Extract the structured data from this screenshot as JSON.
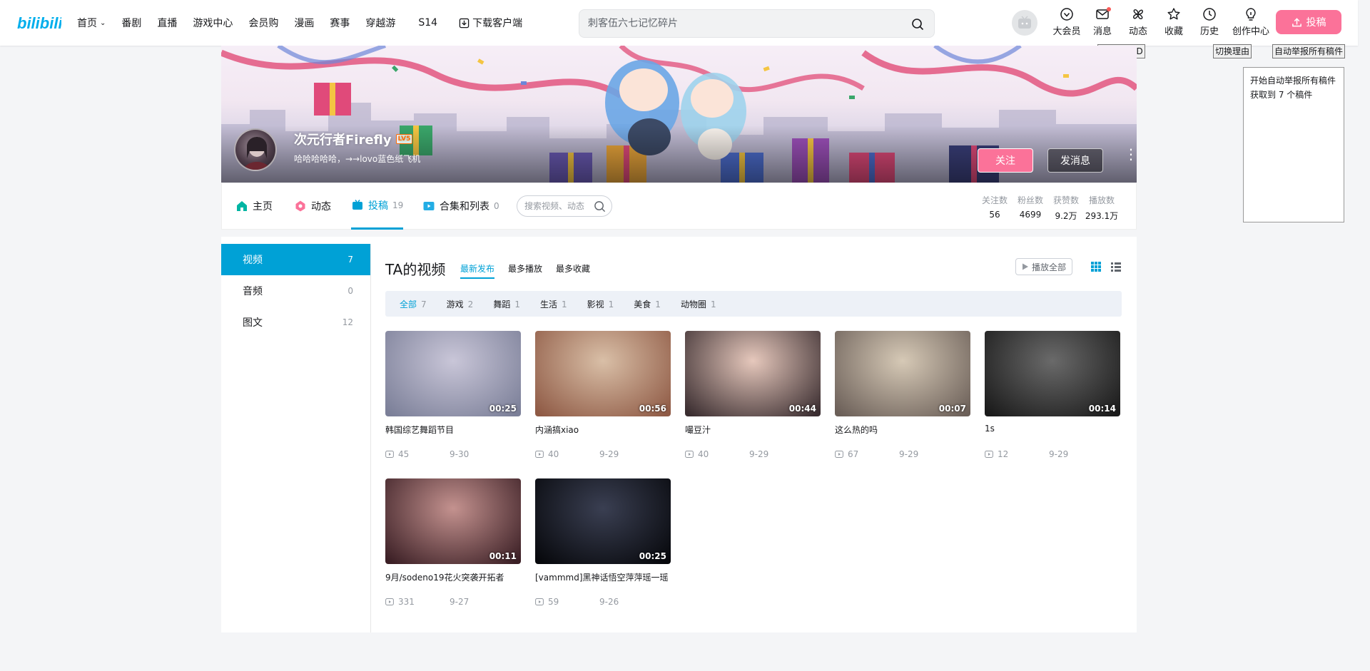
{
  "topnav": {
    "items": [
      "首页",
      "番剧",
      "直播",
      "游戏中心",
      "会员购",
      "漫画",
      "赛事",
      "穿越游",
      "S14",
      "下载客户端"
    ],
    "search_placeholder": "刺客伍六七记忆碎片",
    "icons": [
      {
        "label": "大会员",
        "icon": "vip-icon"
      },
      {
        "label": "消息",
        "icon": "mail-icon"
      },
      {
        "label": "动态",
        "icon": "windmill-icon"
      },
      {
        "label": "收藏",
        "icon": "star-icon"
      },
      {
        "label": "历史",
        "icon": "clock-icon"
      },
      {
        "label": "创作中心",
        "icon": "bulb-icon"
      }
    ],
    "upload_label": "投稿",
    "accent": "#fb7299"
  },
  "extension": {
    "copy_id": "复制用户ID",
    "switch_reason": "切换理由",
    "auto_report": "自动举报所有稿件",
    "log_lines": [
      "开始自动举报所有稿件",
      "获取到 7 个稿件"
    ]
  },
  "profile": {
    "name": "次元行者Firefly",
    "level": "LV5",
    "sign": "哈哈哈哈哈，→→lovo蓝色纸飞机",
    "follow_label": "关注",
    "message_label": "发消息"
  },
  "tabs": [
    {
      "label": "主页",
      "count": ""
    },
    {
      "label": "动态",
      "count": ""
    },
    {
      "label": "投稿",
      "count": "19"
    },
    {
      "label": "合集和列表",
      "count": "0"
    }
  ],
  "tab_search_placeholder": "搜索视频、动态",
  "stats": [
    {
      "label": "关注数",
      "value": "56"
    },
    {
      "label": "粉丝数",
      "value": "4699"
    },
    {
      "label": "获赞数",
      "value": "9.2万"
    },
    {
      "label": "播放数",
      "value": "293.1万"
    }
  ],
  "side": [
    {
      "label": "视频",
      "count": "7"
    },
    {
      "label": "音频",
      "count": "0"
    },
    {
      "label": "图文",
      "count": "12"
    }
  ],
  "content": {
    "title": "TA的视频",
    "sorts": [
      "最新发布",
      "最多播放",
      "最多收藏"
    ],
    "play_all": "播放全部",
    "filters": [
      {
        "label": "全部",
        "count": "7"
      },
      {
        "label": "游戏",
        "count": "2"
      },
      {
        "label": "舞蹈",
        "count": "1"
      },
      {
        "label": "生活",
        "count": "1"
      },
      {
        "label": "影视",
        "count": "1"
      },
      {
        "label": "美食",
        "count": "1"
      },
      {
        "label": "动物圈",
        "count": "1"
      }
    ]
  },
  "videos": [
    {
      "title": "韩国综艺舞蹈节目",
      "duration": "00:25",
      "plays": "45",
      "date": "9-30",
      "colors": [
        "#c9c6d8",
        "#7b7f98"
      ]
    },
    {
      "title": "内涵搞xiao",
      "duration": "00:56",
      "plays": "40",
      "date": "9-29",
      "colors": [
        "#d9bfa7",
        "#8f5a45"
      ]
    },
    {
      "title": "嘬豆汁",
      "duration": "00:44",
      "plays": "40",
      "date": "9-29",
      "colors": [
        "#e6c8bc",
        "#3a2d30"
      ]
    },
    {
      "title": "这么热的吗",
      "duration": "00:07",
      "plays": "67",
      "date": "9-29",
      "colors": [
        "#d6c9b6",
        "#6b5f58"
      ]
    },
    {
      "title": "1s",
      "duration": "00:14",
      "plays": "12",
      "date": "9-29",
      "colors": [
        "#6a6a6a",
        "#1a1a1a"
      ]
    },
    {
      "title": "9月/sodeno19花火突袭开拓者",
      "duration": "00:11",
      "plays": "331",
      "date": "9-27",
      "colors": [
        "#c4928f",
        "#3b1f25"
      ]
    },
    {
      "title": "[vammmd]黑神话悟空萍萍瑶一瑶",
      "duration": "00:25",
      "plays": "59",
      "date": "9-26",
      "colors": [
        "#3a3f52",
        "#07080c"
      ]
    }
  ]
}
